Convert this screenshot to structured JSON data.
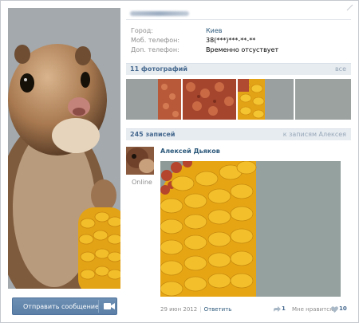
{
  "profile": {
    "photo_icon": "chipmunk-photo",
    "send_message_label": "Отправить сообщение",
    "send_icon": "camera-icon"
  },
  "info": [
    {
      "label": "Город:",
      "value": "Киев"
    },
    {
      "label": "Моб. телефон:",
      "value": "38(***)***-**-**"
    },
    {
      "label": "Доп. телефон:",
      "value": "Временно отсуствует"
    }
  ],
  "photos": {
    "title": "11 фотографий",
    "all_link": "все"
  },
  "wall": {
    "title": "245 записей",
    "to_user_link": "к записям Алексея"
  },
  "post": {
    "author": "Алексей Дьяков",
    "status": "Online",
    "date": "29 июн 2012",
    "reply_label": "Ответить",
    "shares": "1",
    "like_label": "Мне нравится",
    "likes": "10"
  },
  "colors": {
    "link": "#2b587a",
    "section_bg": "#e7ecf1",
    "button": "#5b7fa6"
  }
}
